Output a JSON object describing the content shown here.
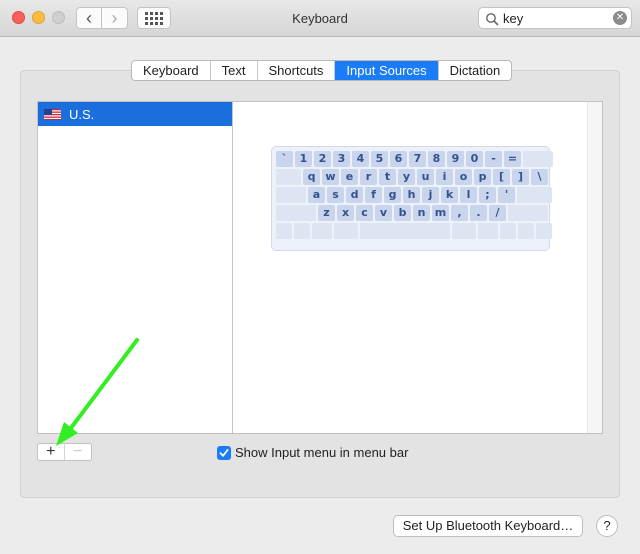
{
  "window": {
    "title": "Keyboard",
    "nav_back": "‹",
    "nav_forward": "›"
  },
  "search": {
    "value": "key",
    "clear": "✕"
  },
  "tabs": [
    {
      "label": "Keyboard",
      "active": false
    },
    {
      "label": "Text",
      "active": false
    },
    {
      "label": "Shortcuts",
      "active": false
    },
    {
      "label": "Input Sources",
      "active": true
    },
    {
      "label": "Dictation",
      "active": false
    }
  ],
  "input_sources": [
    {
      "label": "U.S.",
      "flag": "us-flag-icon",
      "selected": true
    }
  ],
  "keyboard_preview": {
    "rows": [
      [
        "`",
        "1",
        "2",
        "3",
        "4",
        "5",
        "6",
        "7",
        "8",
        "9",
        "0",
        "-",
        "="
      ],
      [
        "q",
        "w",
        "e",
        "r",
        "t",
        "y",
        "u",
        "i",
        "o",
        "p",
        "[",
        "]",
        "\\"
      ],
      [
        "a",
        "s",
        "d",
        "f",
        "g",
        "h",
        "j",
        "k",
        "l",
        ";",
        "'"
      ],
      [
        "z",
        "x",
        "c",
        "v",
        "b",
        "n",
        "m",
        ",",
        ".",
        "/"
      ]
    ]
  },
  "controls": {
    "add": "+",
    "remove": "−",
    "show_input_menu_label": "Show Input menu in menu bar",
    "show_input_menu_checked": true,
    "bluetooth_button": "Set Up Bluetooth Keyboard…",
    "help": "?"
  },
  "colors": {
    "accent": "#1a7cf7",
    "selection": "#1a6fdc",
    "annotation_arrow": "#33ee22"
  }
}
